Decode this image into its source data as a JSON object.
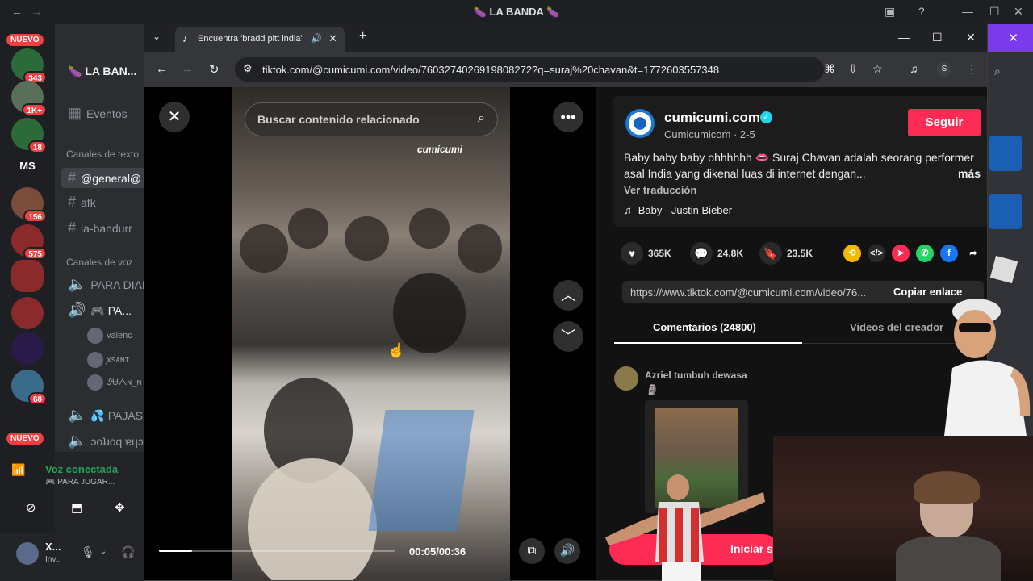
{
  "discord": {
    "title": "🍆 LA BANDA 🍆",
    "guild_name": "🍆 LA BAN...",
    "events_label": "Eventos",
    "text_category": "Canales de texto",
    "voice_category": "Canales de voz",
    "text_channels": [
      "@general@",
      "afk",
      "la-bandurr"
    ],
    "voice_channels": [
      "PARA DIAL",
      "🎮 PA...",
      "💦 PAJAS",
      "ɔoʇɹoq ɐɥɔɐN"
    ],
    "voice_users": [
      "valenc",
      "ꭗsᴀɴᴛ",
      "ᏭɄᗅɴ_ɴ"
    ],
    "servers": [
      {
        "label": "",
        "badge": "343"
      },
      {
        "label": "",
        "badge": "1K+"
      },
      {
        "label": "",
        "badge": "18"
      },
      {
        "label": "MS",
        "badge": ""
      },
      {
        "label": "",
        "badge": "156"
      },
      {
        "label": "",
        "badge": "575"
      },
      {
        "label": "",
        "badge": ""
      },
      {
        "label": "",
        "badge": ""
      },
      {
        "label": "",
        "badge": ""
      },
      {
        "label": "",
        "badge": "68"
      },
      {
        "label": "",
        "badge": ""
      }
    ],
    "new_pill": "NUEVO",
    "voice_status": "Voz conectada",
    "voice_channel_now": "🎮 PARA JUGAR...",
    "user_name": "X...",
    "user_status": "Inv..."
  },
  "browser": {
    "tab_title": "Encuentra 'bradd pitt india'",
    "url": "tiktok.com/@cumicumi.com/video/7603274026919808272?q=suraj%20chavan&t=1772603557348",
    "profile_initial": "S"
  },
  "tiktok": {
    "search_placeholder": "Buscar contenido relacionado",
    "watermark": "cumicumi",
    "time": "00:05/00:36",
    "progress": 0.14,
    "account_name": "cumicumi.com",
    "account_sub": "Cumicumicom · 2-5",
    "follow_label": "Seguir",
    "description": "Baby baby baby ohhhhhh 👄 Suraj Chavan adalah seorang performer asal India yang dikenal luas di internet dengan...",
    "more_label": "más",
    "translate_label": "Ver traducción",
    "music": "Baby - Justin Bieber",
    "likes": "365K",
    "comments": "24.8K",
    "saves": "23.5K",
    "link": "https://www.tiktok.com/@cumicumi.com/video/76...",
    "copy_label": "Copiar enlace",
    "tab_comments": "Comentarios (24800)",
    "tab_videos": "Videos del creador",
    "comment_user": "Azriel tumbuh dewasa",
    "comment_emoji": "🗿",
    "live_label": "Iniciar s",
    "share_colors": [
      "#f5b800",
      "#2a2a2a",
      "#fe2c55",
      "#25d366",
      "#1877f2"
    ],
    "accent": "#fe2c55"
  }
}
